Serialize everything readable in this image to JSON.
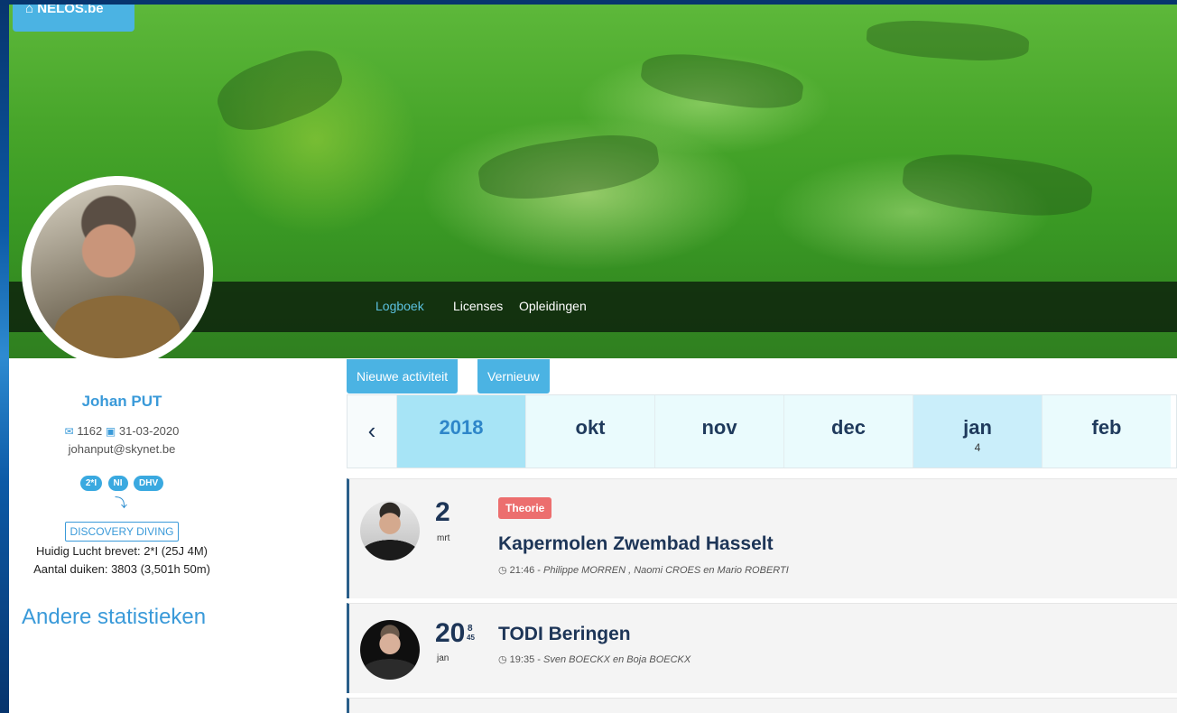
{
  "brand": {
    "label": "NELOS.be",
    "icon": "home-icon"
  },
  "nav": {
    "items": [
      {
        "label": "Logboek",
        "active": true
      },
      {
        "label": "Licenses",
        "active": false
      },
      {
        "label": "Opleidingen",
        "active": false
      }
    ]
  },
  "profile": {
    "name": "Johan PUT",
    "member_no": "1162",
    "date": "31-03-2020",
    "email": "johanput@skynet.be",
    "badges": [
      "2*I",
      "NI",
      "DHV"
    ],
    "discovery_label": "DISCOVERY DIVING",
    "brevet_line": "Huidig Lucht brevet: 2*I (25J 4M)",
    "dives_line": "Aantal duiken: 3803 (3,501h 50m)",
    "other_stats_link": "Andere statistieken"
  },
  "actions": {
    "new_activity": "Nieuwe activiteit",
    "refresh": "Vernieuw"
  },
  "months": {
    "prev_icon": "‹",
    "cells": [
      {
        "label": "2018",
        "count": "",
        "kind": "year"
      },
      {
        "label": "okt",
        "count": ""
      },
      {
        "label": "nov",
        "count": ""
      },
      {
        "label": "dec",
        "count": ""
      },
      {
        "label": "jan",
        "count": "4",
        "kind": "sel"
      },
      {
        "label": "feb",
        "count": ""
      }
    ]
  },
  "activities": [
    {
      "day": "2",
      "month": "mrt",
      "sup_top": "",
      "sup_bottom": "",
      "tag": "Theorie",
      "title": "Kapermolen Zwembad Hasselt",
      "time": "21:46",
      "people": "Philippe MORREN , Naomi CROES en Mario ROBERTI"
    },
    {
      "day": "20",
      "month": "jan",
      "sup_top": "8",
      "sup_bottom": "45",
      "tag": "",
      "title": "TODI Beringen",
      "time": "19:35",
      "people": "Sven BOECKX en Boja BOECKX"
    }
  ],
  "colors": {
    "accent": "#4bb3e3",
    "link": "#3a9ad9",
    "tag_red": "#ec6e6e",
    "heading": "#1d3557"
  }
}
